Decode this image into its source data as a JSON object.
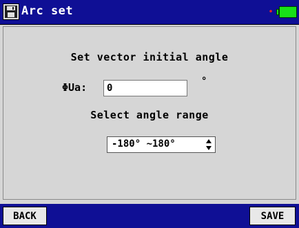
{
  "window": {
    "title": "Arc set",
    "app_icon": "floppy-disk-icon",
    "status_dot": "•",
    "battery_icon": "battery-icon",
    "colors": {
      "titlebar": "#0f0f95",
      "background": "#d6d6d6",
      "battery": "#18e018",
      "status_dot": "#ff2222"
    }
  },
  "main": {
    "heading": "Set vector initial angle",
    "angle_label": "ΦUa:",
    "angle_value": "0",
    "degree_symbol": "°",
    "range_heading": "Select angle range",
    "range_selected": "-180° ~180°",
    "spinner_icon": "up-down-arrows-icon"
  },
  "footer": {
    "back_label": "BACK",
    "save_label": "SAVE"
  }
}
